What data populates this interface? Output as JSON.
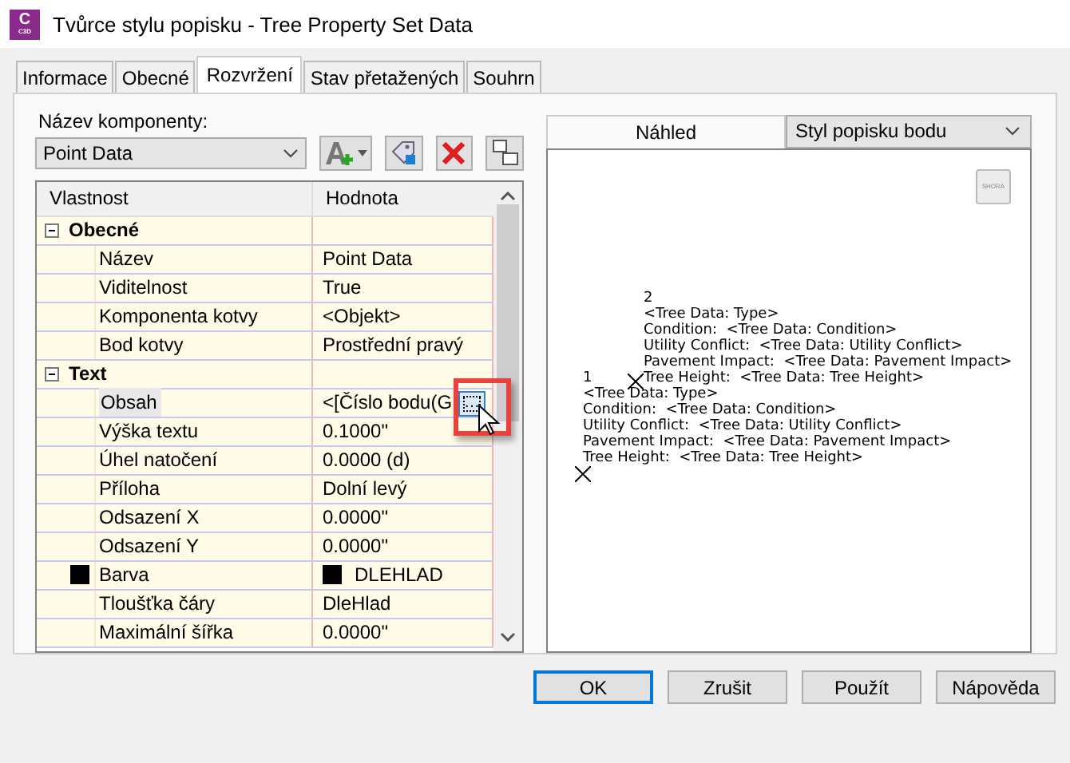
{
  "window": {
    "title": "Tvůrce stylu popisku - Tree Property Set Data",
    "icon": {
      "letter": "C",
      "sub": "C3D"
    }
  },
  "tabs": [
    {
      "label": "Informace",
      "selected": false
    },
    {
      "label": "Obecné",
      "selected": false
    },
    {
      "label": "Rozvržení",
      "selected": true
    },
    {
      "label": "Stav přetažených",
      "selected": false
    },
    {
      "label": "Souhrn",
      "selected": false
    }
  ],
  "component": {
    "label": "Název komponenty:",
    "value": "Point Data"
  },
  "grid": {
    "columns": [
      "Vlastnost",
      "Hodnota"
    ],
    "groups": [
      {
        "name": "Obecné",
        "expanded": true,
        "rows": [
          {
            "name": "Název",
            "value": "Point Data",
            "selected": false
          },
          {
            "name": "Viditelnost",
            "value": "True",
            "selected": false
          },
          {
            "name": "Komponenta kotvy",
            "value": "<Objekt>",
            "selected": false
          },
          {
            "name": "Bod kotvy",
            "value": "Prostřední pravý",
            "selected": false
          }
        ]
      },
      {
        "name": "Text",
        "expanded": true,
        "rows": [
          {
            "name": "Obsah",
            "value": "<[Číslo bodu(G",
            "selected": true,
            "kind": "ellipsis",
            "button": "…"
          },
          {
            "name": "Výška textu",
            "value": "0.1000\"",
            "selected": false
          },
          {
            "name": "Úhel natočení",
            "value": "0.0000 (d)",
            "selected": false
          },
          {
            "name": "Příloha",
            "value": "Dolní levý",
            "selected": false
          },
          {
            "name": "Odsazení X",
            "value": "0.0000\"",
            "selected": false
          },
          {
            "name": "Odsazení Y",
            "value": "0.0000\"",
            "selected": false
          },
          {
            "name": "Barva",
            "value": "DLEHLAD",
            "selected": false,
            "kind": "color",
            "color": "#000000"
          },
          {
            "name": "Tloušťka čáry",
            "value": "DleHlad",
            "selected": false
          },
          {
            "name": "Maximální šířka",
            "value": "0.0000\"",
            "selected": false
          }
        ]
      }
    ]
  },
  "preview": {
    "tab": "Náhled",
    "style": "Styl popisku bodu",
    "view_button": "SHORA",
    "labels": [
      {
        "lines": [
          "2",
          "<Tree Data: Type>",
          "Condition:  <Tree Data: Condition>",
          "Utility Conflict:  <Tree Data: Utility Conflict>",
          "Pavement Impact:  <Tree Data: Pavement Impact>",
          "Tree Height:  <Tree Data: Tree Height>"
        ]
      },
      {
        "lines": [
          "1",
          "<Tree Data: Type>",
          "Condition:  <Tree Data: Condition>",
          "Utility Conflict:  <Tree Data: Utility Conflict>",
          "Pavement Impact:  <Tree Data: Pavement Impact>",
          "Tree Height:  <Tree Data: Tree Height>"
        ]
      }
    ]
  },
  "buttons": [
    {
      "label": "OK",
      "default": true
    },
    {
      "label": "Zrušit",
      "default": false
    },
    {
      "label": "Použít",
      "default": false
    },
    {
      "label": "Nápověda",
      "default": false
    }
  ]
}
